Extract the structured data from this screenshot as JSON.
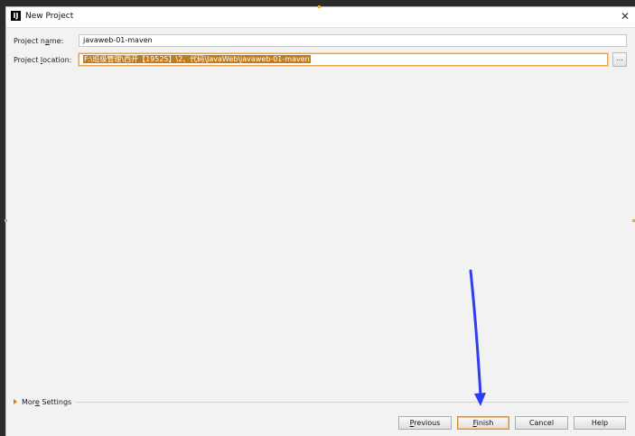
{
  "window": {
    "title": "New Project",
    "icon_text": "IJ"
  },
  "form": {
    "name_label_pre": "Project n",
    "name_label_mn": "a",
    "name_label_post": "me:",
    "name_value": "javaweb-01-maven",
    "location_label_pre": "Project ",
    "location_label_mn": "l",
    "location_label_post": "ocation:",
    "location_value": "F:\\班级管理\\西开【19525】\\2、代码\\JavaWeb\\javaweb-01-maven",
    "browse_label": "..."
  },
  "more_settings": {
    "pre": "Mor",
    "mn": "e",
    "post": " Settings"
  },
  "buttons": {
    "previous_mn": "P",
    "previous_rest": "revious",
    "finish_mn": "F",
    "finish_rest": "inish",
    "cancel": "Cancel",
    "help": "Help"
  },
  "colors": {
    "accent": "#e8a54a",
    "selection": "#c07a1a",
    "arrow": "#2f3df0"
  },
  "icons": {
    "close": "close-icon",
    "app": "intellij-app-icon",
    "expand": "triangle-right-icon",
    "annotation": "blue-arrow-annotation"
  }
}
